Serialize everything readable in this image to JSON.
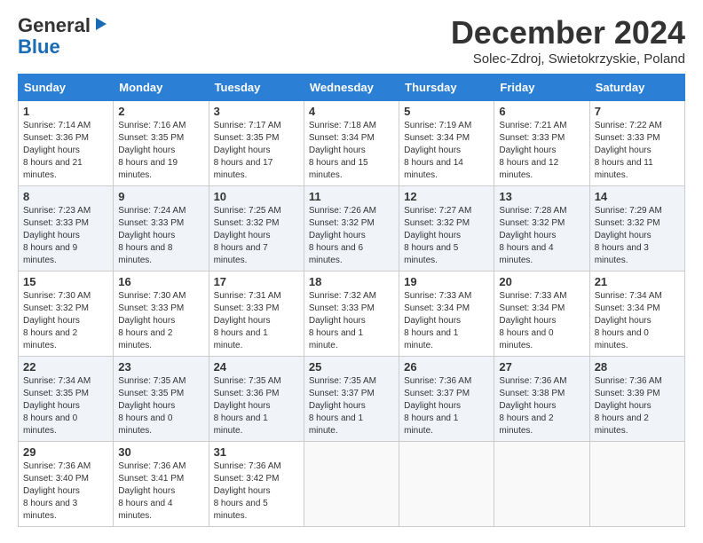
{
  "header": {
    "logo_general": "General",
    "logo_blue": "Blue",
    "month_title": "December 2024",
    "location": "Solec-Zdroj, Swietokrzyskie, Poland"
  },
  "weekdays": [
    "Sunday",
    "Monday",
    "Tuesday",
    "Wednesday",
    "Thursday",
    "Friday",
    "Saturday"
  ],
  "weeks": [
    [
      {
        "day": "1",
        "sunrise": "7:14 AM",
        "sunset": "3:36 PM",
        "daylight": "8 hours and 21 minutes."
      },
      {
        "day": "2",
        "sunrise": "7:16 AM",
        "sunset": "3:35 PM",
        "daylight": "8 hours and 19 minutes."
      },
      {
        "day": "3",
        "sunrise": "7:17 AM",
        "sunset": "3:35 PM",
        "daylight": "8 hours and 17 minutes."
      },
      {
        "day": "4",
        "sunrise": "7:18 AM",
        "sunset": "3:34 PM",
        "daylight": "8 hours and 15 minutes."
      },
      {
        "day": "5",
        "sunrise": "7:19 AM",
        "sunset": "3:34 PM",
        "daylight": "8 hours and 14 minutes."
      },
      {
        "day": "6",
        "sunrise": "7:21 AM",
        "sunset": "3:33 PM",
        "daylight": "8 hours and 12 minutes."
      },
      {
        "day": "7",
        "sunrise": "7:22 AM",
        "sunset": "3:33 PM",
        "daylight": "8 hours and 11 minutes."
      }
    ],
    [
      {
        "day": "8",
        "sunrise": "7:23 AM",
        "sunset": "3:33 PM",
        "daylight": "8 hours and 9 minutes."
      },
      {
        "day": "9",
        "sunrise": "7:24 AM",
        "sunset": "3:33 PM",
        "daylight": "8 hours and 8 minutes."
      },
      {
        "day": "10",
        "sunrise": "7:25 AM",
        "sunset": "3:32 PM",
        "daylight": "8 hours and 7 minutes."
      },
      {
        "day": "11",
        "sunrise": "7:26 AM",
        "sunset": "3:32 PM",
        "daylight": "8 hours and 6 minutes."
      },
      {
        "day": "12",
        "sunrise": "7:27 AM",
        "sunset": "3:32 PM",
        "daylight": "8 hours and 5 minutes."
      },
      {
        "day": "13",
        "sunrise": "7:28 AM",
        "sunset": "3:32 PM",
        "daylight": "8 hours and 4 minutes."
      },
      {
        "day": "14",
        "sunrise": "7:29 AM",
        "sunset": "3:32 PM",
        "daylight": "8 hours and 3 minutes."
      }
    ],
    [
      {
        "day": "15",
        "sunrise": "7:30 AM",
        "sunset": "3:32 PM",
        "daylight": "8 hours and 2 minutes."
      },
      {
        "day": "16",
        "sunrise": "7:30 AM",
        "sunset": "3:33 PM",
        "daylight": "8 hours and 2 minutes."
      },
      {
        "day": "17",
        "sunrise": "7:31 AM",
        "sunset": "3:33 PM",
        "daylight": "8 hours and 1 minute."
      },
      {
        "day": "18",
        "sunrise": "7:32 AM",
        "sunset": "3:33 PM",
        "daylight": "8 hours and 1 minute."
      },
      {
        "day": "19",
        "sunrise": "7:33 AM",
        "sunset": "3:34 PM",
        "daylight": "8 hours and 1 minute."
      },
      {
        "day": "20",
        "sunrise": "7:33 AM",
        "sunset": "3:34 PM",
        "daylight": "8 hours and 0 minutes."
      },
      {
        "day": "21",
        "sunrise": "7:34 AM",
        "sunset": "3:34 PM",
        "daylight": "8 hours and 0 minutes."
      }
    ],
    [
      {
        "day": "22",
        "sunrise": "7:34 AM",
        "sunset": "3:35 PM",
        "daylight": "8 hours and 0 minutes."
      },
      {
        "day": "23",
        "sunrise": "7:35 AM",
        "sunset": "3:35 PM",
        "daylight": "8 hours and 0 minutes."
      },
      {
        "day": "24",
        "sunrise": "7:35 AM",
        "sunset": "3:36 PM",
        "daylight": "8 hours and 1 minute."
      },
      {
        "day": "25",
        "sunrise": "7:35 AM",
        "sunset": "3:37 PM",
        "daylight": "8 hours and 1 minute."
      },
      {
        "day": "26",
        "sunrise": "7:36 AM",
        "sunset": "3:37 PM",
        "daylight": "8 hours and 1 minute."
      },
      {
        "day": "27",
        "sunrise": "7:36 AM",
        "sunset": "3:38 PM",
        "daylight": "8 hours and 2 minutes."
      },
      {
        "day": "28",
        "sunrise": "7:36 AM",
        "sunset": "3:39 PM",
        "daylight": "8 hours and 2 minutes."
      }
    ],
    [
      {
        "day": "29",
        "sunrise": "7:36 AM",
        "sunset": "3:40 PM",
        "daylight": "8 hours and 3 minutes."
      },
      {
        "day": "30",
        "sunrise": "7:36 AM",
        "sunset": "3:41 PM",
        "daylight": "8 hours and 4 minutes."
      },
      {
        "day": "31",
        "sunrise": "7:36 AM",
        "sunset": "3:42 PM",
        "daylight": "8 hours and 5 minutes."
      },
      null,
      null,
      null,
      null
    ]
  ]
}
